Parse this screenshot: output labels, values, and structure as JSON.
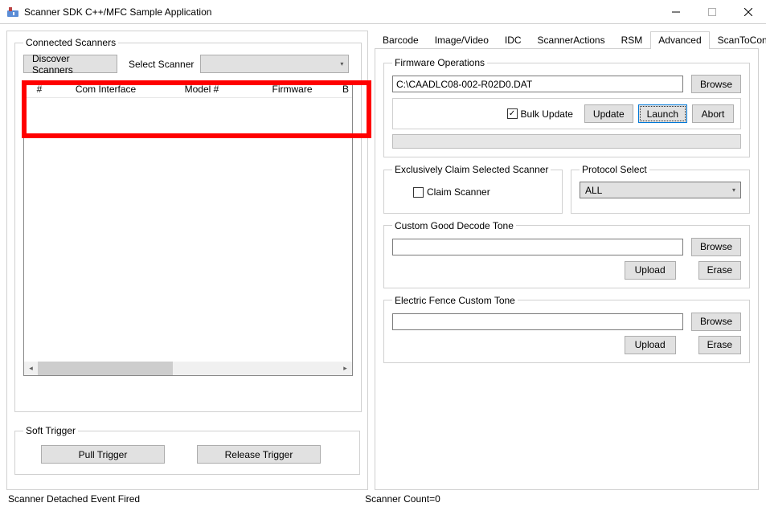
{
  "window": {
    "title": "Scanner SDK C++/MFC Sample Application"
  },
  "left": {
    "connected_scanners_label": "Connected Scanners",
    "discover_btn": "Discover Scanners",
    "select_scanner_label": "Select Scanner",
    "columns": {
      "c0": "#",
      "c1": "Com Interface",
      "c2": "Model #",
      "c3": "Firmware",
      "c4": "B"
    },
    "soft_trigger_label": "Soft Trigger",
    "pull_trigger_btn": "Pull Trigger",
    "release_trigger_btn": "Release Trigger"
  },
  "tabs": {
    "barcode": "Barcode",
    "image_video": "Image/Video",
    "idc": "IDC",
    "scanner_actions": "ScannerActions",
    "rsm": "RSM",
    "advanced": "Advanced",
    "scan_to_connect": "ScanToConnect"
  },
  "firmware": {
    "legend": "Firmware Operations",
    "path": "C:\\CAADLC08-002-R02D0.DAT",
    "browse": "Browse",
    "bulk_update": "Bulk Update",
    "update": "Update",
    "launch": "Launch",
    "abort": "Abort"
  },
  "claim": {
    "legend": "Exclusively Claim Selected Scanner",
    "claim_scanner": "Claim Scanner"
  },
  "protocol": {
    "legend": "Protocol Select",
    "value": "ALL"
  },
  "good_tone": {
    "legend": "Custom Good Decode Tone",
    "browse": "Browse",
    "upload": "Upload",
    "erase": "Erase"
  },
  "fence_tone": {
    "legend": "Electric Fence Custom Tone",
    "browse": "Browse",
    "upload": "Upload",
    "erase": "Erase"
  },
  "status": {
    "event": "Scanner Detached Event Fired",
    "count": "Scanner Count=0"
  }
}
